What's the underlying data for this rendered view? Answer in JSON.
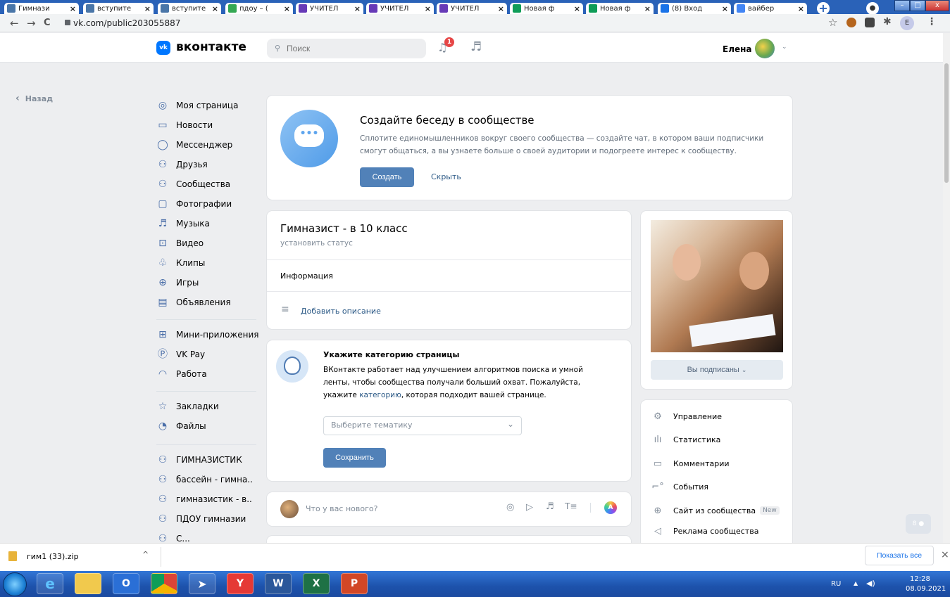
{
  "browser": {
    "tabs": [
      {
        "label": "Гимнази",
        "icon": "vk-icon",
        "color": "#4a76a8"
      },
      {
        "label": "вступите",
        "icon": "vk-icon",
        "color": "#4a76a8"
      },
      {
        "label": "вступите",
        "icon": "vk-icon",
        "color": "#4a76a8"
      },
      {
        "label": "пдоу – (",
        "icon": "drive-icon",
        "color": "#34a853"
      },
      {
        "label": "УЧИТЕЛ",
        "icon": "forms-icon",
        "color": "#673ab7"
      },
      {
        "label": "УЧИТЕЛ",
        "icon": "forms-icon",
        "color": "#673ab7"
      },
      {
        "label": "УЧИТЕЛ",
        "icon": "forms-icon",
        "color": "#673ab7"
      },
      {
        "label": "Новая ф",
        "icon": "sheets-icon",
        "color": "#0f9d58"
      },
      {
        "label": "Новая ф",
        "icon": "sheets-icon",
        "color": "#0f9d58"
      },
      {
        "label": "(8) Вход",
        "icon": "mail-icon",
        "color": "#1a73e8"
      },
      {
        "label": "вайбер",
        "icon": "google-icon",
        "color": "#4285f4"
      }
    ],
    "url": "vk.com/public203055887",
    "back_glyph": "←",
    "forward_glyph": "→",
    "reload_glyph": "C"
  },
  "vk": {
    "logo_text": "вконтакте",
    "logo_mark": "vk",
    "search_placeholder": "Поиск",
    "notifications_count": "1",
    "user_name": "Елена",
    "back_label": "Назад"
  },
  "sidebar": {
    "main": [
      {
        "label": "Моя страница",
        "icon": "user-icon"
      },
      {
        "label": "Новости",
        "icon": "news-icon"
      },
      {
        "label": "Мессенджер",
        "icon": "message-icon"
      },
      {
        "label": "Друзья",
        "icon": "friends-icon"
      },
      {
        "label": "Сообщества",
        "icon": "groups-icon"
      },
      {
        "label": "Фотографии",
        "icon": "photo-icon"
      },
      {
        "label": "Музыка",
        "icon": "music-icon"
      },
      {
        "label": "Видео",
        "icon": "video-icon"
      },
      {
        "label": "Клипы",
        "icon": "clips-icon"
      },
      {
        "label": "Игры",
        "icon": "games-icon"
      },
      {
        "label": "Объявления",
        "icon": "ads-icon"
      }
    ],
    "apps": [
      {
        "label": "Мини-приложения",
        "icon": "apps-icon"
      },
      {
        "label": "VK Pay",
        "icon": "pay-icon"
      },
      {
        "label": "Работа",
        "icon": "work-icon"
      }
    ],
    "extra": [
      {
        "label": "Закладки",
        "icon": "bookmark-icon"
      },
      {
        "label": "Файлы",
        "icon": "file-icon"
      }
    ],
    "groups": [
      {
        "label": "ГИМНАЗИСТИК",
        "icon": "groups-icon"
      },
      {
        "label": "бассейн - гимна..",
        "icon": "groups-icon"
      },
      {
        "label": "гимназистик - в..",
        "icon": "groups-icon"
      },
      {
        "label": "ПДОУ гимназии",
        "icon": "groups-icon"
      },
      {
        "label": "С...",
        "icon": "groups-icon"
      }
    ]
  },
  "chat_promo": {
    "title": "Создайте беседу в сообществе",
    "text_1": "Сплотите единомышленников вокруг своего сообщества — создайте чат, в котором ваши подписчики",
    "text_2": "смогут общаться, а вы узнаете больше о своей аудитории и подогреете интерес к сообществу.",
    "create_label": "Создать",
    "hide_label": "Скрыть"
  },
  "community": {
    "name": "Гимназист - в 10 класс",
    "status_prompt": "установить статус",
    "info_label": "Информация",
    "add_description": "Добавить описание"
  },
  "category": {
    "title": "Укажите категорию страницы",
    "text_1": "ВКонтакте работает над улучшением алгоритмов поиска и умной",
    "text_2": "ленты, чтобы сообщества получали больший охват. Пожалуйста,",
    "text_3_pre": "укажите ",
    "text_3_link": "категорию",
    "text_3_post": ", которая подходит вашей странице.",
    "select_placeholder": "Выберите тематику",
    "save_label": "Сохранить"
  },
  "composer": {
    "placeholder": "Что у вас нового?"
  },
  "right": {
    "subscribed_label": "Вы подписаны",
    "menu": [
      {
        "label": "Управление",
        "icon": "gear-icon"
      },
      {
        "label": "Статистика",
        "icon": "stats-icon"
      },
      {
        "label": "Комментарии",
        "icon": "comment-icon"
      },
      {
        "label": "События",
        "icon": "events-icon"
      },
      {
        "label": "Сайт из сообщества",
        "icon": "globe-icon",
        "badge": "New"
      },
      {
        "label": "Реклама сообщества",
        "icon": "megaphone-icon"
      }
    ],
    "float_counter": "8"
  },
  "downloads": {
    "file": "гим1 (33).zip",
    "show_all": "Показать все"
  },
  "taskbar": {
    "lang": "RU",
    "time": "12:28",
    "date": "08.09.2021"
  }
}
